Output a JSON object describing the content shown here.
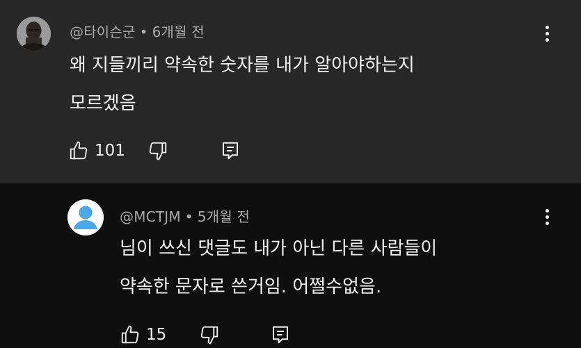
{
  "comments": [
    {
      "author": "@타이슨군",
      "time": "6개월 전",
      "lines": [
        "왜 지들끼리 약속한 숫자를 내가 알아야하는지",
        "모르겠음"
      ],
      "likes": "101",
      "avatar_icon": "profile-photo",
      "background": "#272727"
    },
    {
      "author": "@MCTJM",
      "time": "5개월 전",
      "lines": [
        "님이 쓰신 댓글도 내가 아닌 다른 사람들이",
        "약속한 문자로 쓴거임. 어쩔수없음."
      ],
      "likes": "15",
      "avatar_icon": "default-user-icon",
      "avatar_color": "#4aa8e8",
      "background": "#0f0f0f"
    }
  ],
  "separator": "•",
  "icons": {
    "like": "thumbs-up-icon",
    "dislike": "thumbs-down-icon",
    "reply": "reply-icon",
    "menu": "more-vert-icon"
  }
}
